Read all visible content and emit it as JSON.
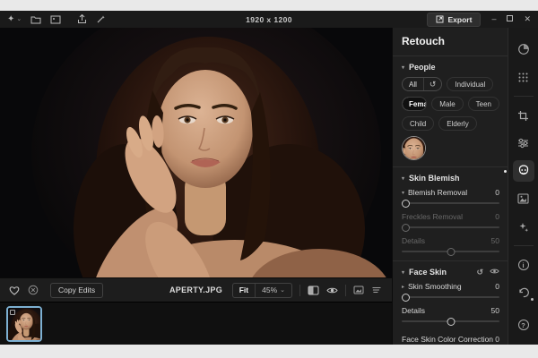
{
  "topbar": {
    "dimensions": "1920 x 1200",
    "export_label": "Export"
  },
  "icons": {
    "star": "✦",
    "caret": "⌄",
    "reset": "↺",
    "minimize": "–",
    "close": "✕",
    "triangle_down": "▾",
    "triangle_right": "▸",
    "info": "i",
    "question": "?",
    "heart": "♡"
  },
  "panel": {
    "title": "Retouch",
    "people": {
      "header": "People",
      "all": "All",
      "individual": "Individual",
      "female": "Female",
      "male": "Male",
      "teen": "Teen",
      "child": "Child",
      "elderly": "Elderly"
    },
    "skin_blemish": {
      "header": "Skin Blemish",
      "sliders": [
        {
          "label": "Blemish Removal",
          "value": "0",
          "pos": 0
        },
        {
          "label": "Freckles Removal",
          "value": "0",
          "pos": 0
        },
        {
          "label": "Details",
          "value": "50",
          "pos": 50
        }
      ]
    },
    "face_skin": {
      "header": "Face Skin",
      "sliders": [
        {
          "label": "Skin Smoothing",
          "value": "0",
          "pos": 0
        },
        {
          "label": "Details",
          "value": "50",
          "pos": 50
        }
      ],
      "color_correction_label": "Face Skin Color Correction",
      "color_correction_value": "0"
    }
  },
  "toolbar": {
    "copy_edits": "Copy Edits",
    "filename": "APERTY.JPG",
    "fit": "Fit",
    "zoom": "45%"
  },
  "colors": {
    "selection_accent": "#7db0d2",
    "panel_bg": "#1f1f1f",
    "canvas_bg": "#08080a"
  }
}
